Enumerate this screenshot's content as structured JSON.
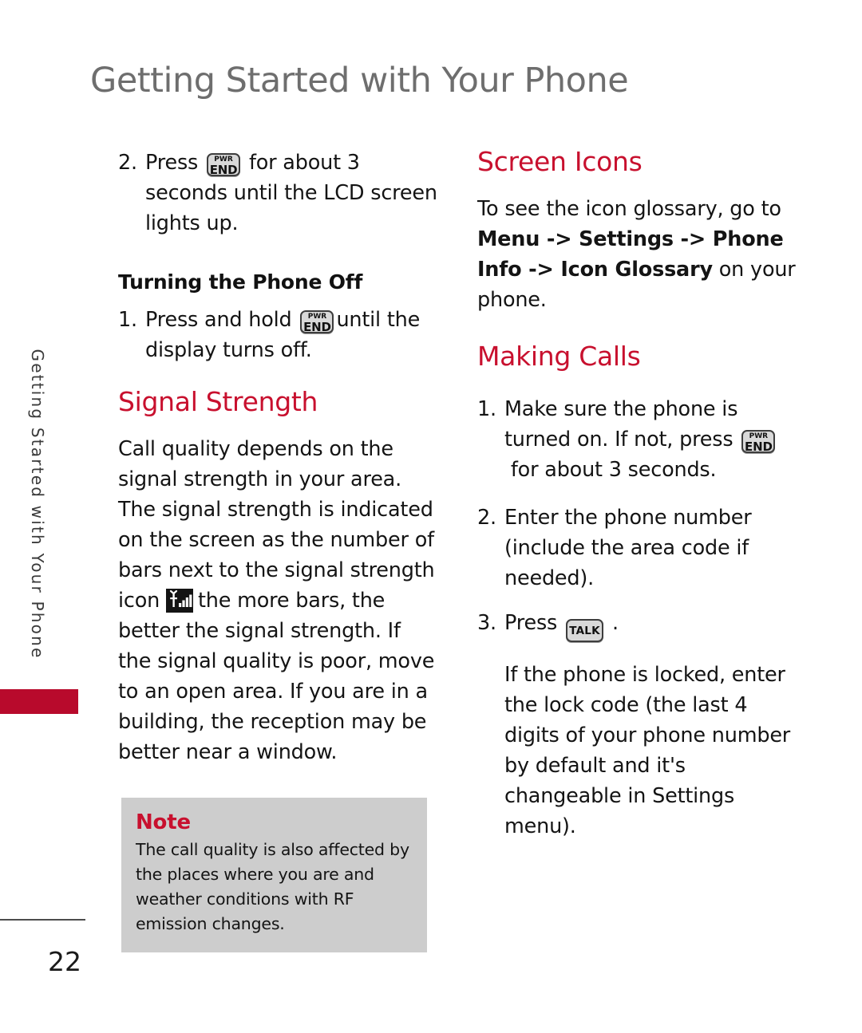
{
  "page": {
    "title": "Getting Started with Your Phone",
    "side_tab_label": "Getting Started with Your Phone",
    "page_number": "22",
    "accent_red": "#c8102e",
    "tab_red": "#b80a2c",
    "title_gray": "#6e6e6e",
    "note_bg": "#cdcdcd"
  },
  "keys": {
    "pwr_top": "PWR",
    "pwr_bottom": "END",
    "talk": "TALK"
  },
  "icons": {
    "signal_strength": "signal-strength-icon",
    "pwr_end_key": "pwr-end-key-icon",
    "talk_key": "talk-key-icon"
  },
  "left_column": {
    "step_turn_on": {
      "number": "2.",
      "text_before": "Press",
      "text_after": "for about 3 seconds until the LCD screen lights up."
    },
    "turning_off_heading": "Turning the Phone Off",
    "step_turn_off": {
      "number": "1.",
      "text_before": "Press and hold",
      "text_after": "until the display turns off."
    },
    "signal_strength": {
      "heading": "Signal Strength",
      "paragraph_before_icon": "Call quality depends on the signal strength in your area. The signal strength is indicated on the screen as the number of bars next to the signal strength icon",
      "paragraph_after_icon": "the more bars, the better the signal strength. If the signal quality is poor, move to an open area. If you are in a building, the reception may be better near a window."
    },
    "note": {
      "title": "Note",
      "text": "The call quality is also affected by the places where you are and weather conditions with RF emission changes."
    }
  },
  "right_column": {
    "screen_icons": {
      "heading": "Screen Icons",
      "text_before": "To see the icon glossary, go to ",
      "path_bold": "Menu -> Settings -> Phone Info -> Icon Glossary",
      "text_after": " on your phone."
    },
    "making_calls": {
      "heading": "Making Calls",
      "step1": {
        "number": "1.",
        "text_before": "Make sure the phone is turned on. If not, press",
        "text_after": "for about 3 seconds."
      },
      "step2": {
        "number": "2.",
        "text": "Enter the phone number (include the area code if needed)."
      },
      "step3": {
        "number": "3.",
        "text_before": "Press",
        "text_after": "."
      },
      "locked_note": "If the phone is locked, enter the lock code (the last 4 digits of your phone number by default and it's changeable in Settings menu)."
    }
  }
}
